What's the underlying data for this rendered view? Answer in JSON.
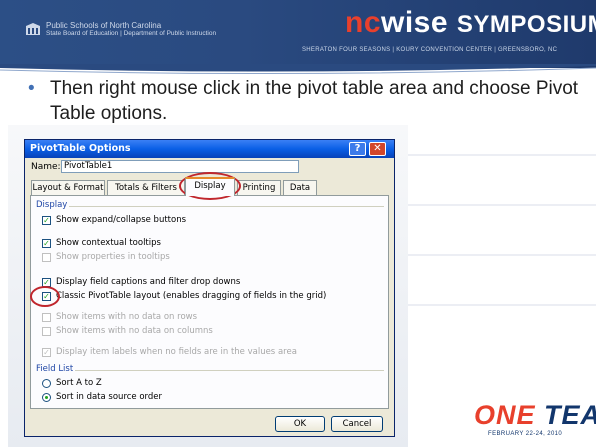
{
  "header": {
    "org_line1": "Public Schools of North Carolina",
    "org_line2": "State Board of Education | Department of Public Instruction",
    "title_nc": "nc",
    "title_rest": "wise ",
    "title_symposium": "SYMPOSIUM",
    "subtitle": "SHERATON FOUR SEASONS | KOURY CONVENTION CENTER | GREENSBORO, NC"
  },
  "bullet": {
    "text": "Then right mouse click in the pivot table area  and choose Pivot Table options."
  },
  "dialog": {
    "title": "PivotTable Options",
    "help_glyph": "?",
    "close_glyph": "✕",
    "name_label": "Name:",
    "name_value": "PivotTable1",
    "tabs": [
      {
        "label": "Layout & Format",
        "active": false
      },
      {
        "label": "Totals & Filters",
        "active": false
      },
      {
        "label": "Display",
        "active": true
      },
      {
        "label": "Printing",
        "active": false
      },
      {
        "label": "Data",
        "active": false
      }
    ],
    "display_section": "Display",
    "options": [
      {
        "label": "Show expand/collapse buttons",
        "checked": true,
        "enabled": true
      },
      {
        "label": "Show contextual tooltips",
        "checked": true,
        "enabled": true
      },
      {
        "label": "Show properties in tooltips",
        "checked": false,
        "enabled": false
      },
      {
        "label": "Display field captions and filter drop downs",
        "checked": true,
        "enabled": true
      },
      {
        "label": "Classic PivotTable layout (enables dragging of fields in the grid)",
        "checked": true,
        "enabled": true
      },
      {
        "label": "Show items with no data on rows",
        "checked": false,
        "enabled": false
      },
      {
        "label": "Show items with no data on columns",
        "checked": false,
        "enabled": false
      },
      {
        "label": "Display item labels when no fields are in the values area",
        "checked": true,
        "enabled": false
      }
    ],
    "field_list_section": "Field List",
    "sort_options": [
      {
        "label": "Sort A to Z",
        "selected": false
      },
      {
        "label": "Sort in data source order",
        "selected": true
      }
    ],
    "ok_label": "OK",
    "cancel_label": "Cancel"
  },
  "footer": {
    "one": "ONE",
    "team": " TEAM",
    "dates": "FEBRUARY 22-24, 2010"
  },
  "colors": {
    "header_blue": "#2a4a80",
    "accent_red": "#e8402c",
    "bullet_blue": "#4170b5",
    "title_bar_blue": "#0a5fe6",
    "highlight_ring": "#c0262d"
  }
}
